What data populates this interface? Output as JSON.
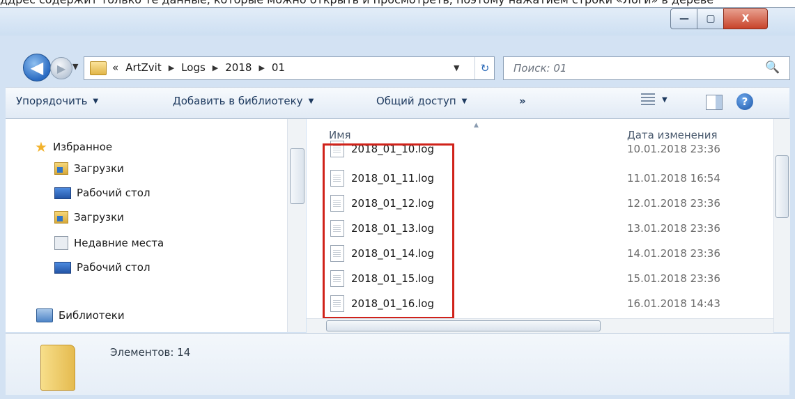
{
  "top_text": "ддрес содержит только те данные, которые можно открыть и просмотреть, поэтому нажатием строки «Логи» в дереве",
  "window": {
    "buttons": {
      "minimize": "—",
      "maximize": "▢",
      "close": "X"
    }
  },
  "nav": {
    "back_icon": "◀",
    "forward_icon": "▶",
    "history_dropdown": "▼"
  },
  "address": {
    "overflow": "«",
    "path": [
      "ArtZvit",
      "Logs",
      "2018",
      "01"
    ],
    "separator": "▶",
    "dropdown": "▼",
    "refresh_icon": "↻"
  },
  "search": {
    "placeholder": "Поиск: 01",
    "icon": "🔍"
  },
  "toolbar": {
    "organize": "Упорядочить",
    "add_to_library": "Добавить в библиотеку",
    "share": "Общий доступ",
    "more": "»",
    "caret": "▼"
  },
  "sidebar": {
    "items": [
      {
        "label": "Избранное",
        "icon": "star-icon"
      },
      {
        "label": "Загрузки",
        "icon": "downloads-folder-icon"
      },
      {
        "label": "Рабочий стол",
        "icon": "desktop-icon"
      },
      {
        "label": "Загрузки",
        "icon": "downloads-folder-icon"
      },
      {
        "label": "Недавние места",
        "icon": "recent-places-icon"
      },
      {
        "label": "Рабочий стол",
        "icon": "desktop-icon"
      },
      {
        "label": "Библиотеки",
        "icon": "libraries-icon"
      }
    ]
  },
  "files": {
    "columns": {
      "name": "Имя",
      "date": "Дата изменения"
    },
    "rows": [
      {
        "name": "2018_01_10.log",
        "date": "10.01.2018 23:36"
      },
      {
        "name": "2018_01_11.log",
        "date": "11.01.2018 16:54"
      },
      {
        "name": "2018_01_12.log",
        "date": "12.01.2018 23:36"
      },
      {
        "name": "2018_01_13.log",
        "date": "13.01.2018 23:36"
      },
      {
        "name": "2018_01_14.log",
        "date": "14.01.2018 23:36"
      },
      {
        "name": "2018_01_15.log",
        "date": "15.01.2018 23:36"
      },
      {
        "name": "2018_01_16.log",
        "date": "16.01.2018 14:43"
      }
    ]
  },
  "details": {
    "items_count": "Элементов: 14"
  },
  "colors": {
    "highlight": "#d0221a",
    "accent": "#2a6bc2"
  }
}
